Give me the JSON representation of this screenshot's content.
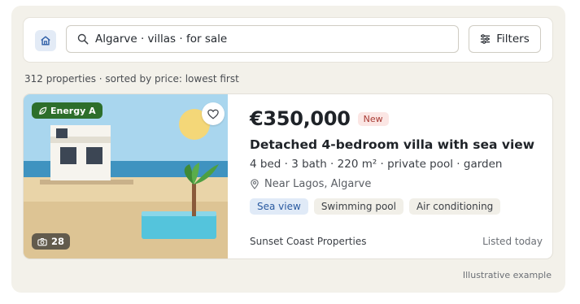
{
  "search": {
    "query": "Algarve · villas · for sale",
    "filters_label": "Filters"
  },
  "results": {
    "summary": "312 properties · sorted by price: lowest first"
  },
  "listing": {
    "energy_badge": "Energy A",
    "photo_count": "28",
    "price": "€350,000",
    "status_badge": "New",
    "title": "Detached 4-bedroom villa with sea view",
    "specs": "4 bed · 3 bath · 220 m² · private pool · garden",
    "location": "Near Lagos, Algarve",
    "tags": [
      "Sea view",
      "Swimming pool",
      "Air conditioning"
    ],
    "agent": "Sunset Coast Properties",
    "listed": "Listed today"
  },
  "footnote": "Illustrative example",
  "icons": {
    "home": "home-icon",
    "search": "search-icon",
    "filters": "sliders-icon",
    "energy": "leaf-icon",
    "favorite": "heart-icon",
    "photos": "camera-icon",
    "location": "map-pin-icon"
  },
  "colors": {
    "energy_badge": "#2d6e2b",
    "new_badge_bg": "#fbe6e4",
    "new_badge_text": "#a83a33",
    "highlight_tag_bg": "#e0eaf7",
    "highlight_tag_text": "#2a5aa0"
  }
}
